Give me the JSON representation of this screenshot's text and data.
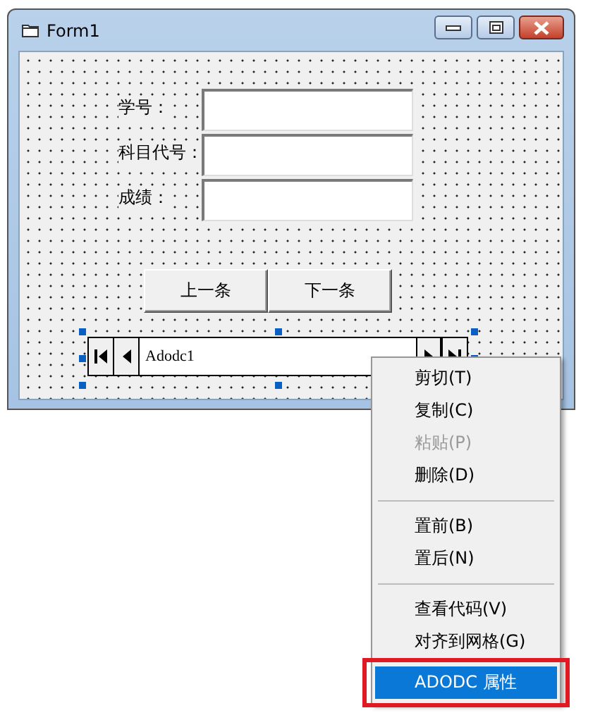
{
  "window": {
    "title": "Form1"
  },
  "fields": [
    {
      "label": "学号："
    },
    {
      "label": "科目代号："
    },
    {
      "label": "成绩："
    }
  ],
  "buttons": [
    "上一条",
    "下一条"
  ],
  "adodc": {
    "caption": "Adodc1",
    "selected": true
  },
  "context_menu": [
    {
      "kind": "item",
      "label": "剪切(T)",
      "disabled": false,
      "selected": false,
      "annotated": false
    },
    {
      "kind": "item",
      "label": "复制(C)",
      "disabled": false,
      "selected": false,
      "annotated": false
    },
    {
      "kind": "item",
      "label": "粘贴(P)",
      "disabled": true,
      "selected": false,
      "annotated": false
    },
    {
      "kind": "item",
      "label": "删除(D)",
      "disabled": false,
      "selected": false,
      "annotated": false
    },
    {
      "kind": "separator"
    },
    {
      "kind": "item",
      "label": "置前(B)",
      "disabled": false,
      "selected": false,
      "annotated": false
    },
    {
      "kind": "item",
      "label": "置后(N)",
      "disabled": false,
      "selected": false,
      "annotated": false
    },
    {
      "kind": "separator"
    },
    {
      "kind": "item",
      "label": "查看代码(V)",
      "disabled": false,
      "selected": false,
      "annotated": false
    },
    {
      "kind": "item",
      "label": "对齐到网格(G)",
      "disabled": false,
      "selected": false,
      "annotated": false
    },
    {
      "kind": "item",
      "label": "ADODC 属性",
      "disabled": false,
      "selected": true,
      "annotated": true
    }
  ]
}
